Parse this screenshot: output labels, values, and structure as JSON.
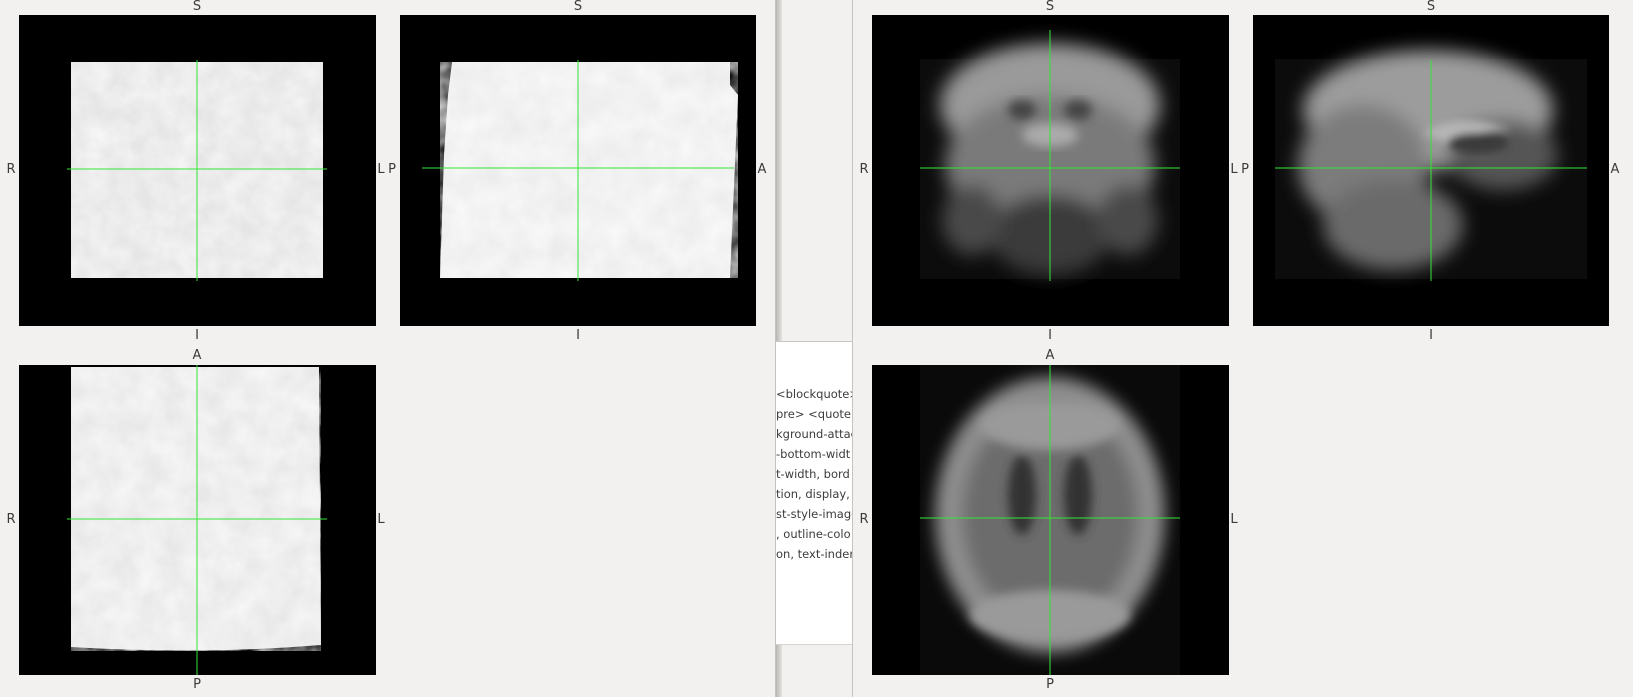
{
  "left_viewer": {
    "views": [
      {
        "id": "coronal",
        "top": "S",
        "bottom": "I",
        "left": "R",
        "right": "L"
      },
      {
        "id": "sagittal",
        "top": "S",
        "bottom": "I",
        "left": "P",
        "right": "A"
      },
      {
        "id": "axial",
        "top": "A",
        "bottom": "P",
        "left": "R",
        "right": "L"
      }
    ]
  },
  "right_viewer": {
    "views": [
      {
        "id": "coronal",
        "top": "S",
        "bottom": "I",
        "left": "R",
        "right": "L"
      },
      {
        "id": "sagittal",
        "top": "S",
        "bottom": "I",
        "left": "P",
        "right": "A"
      },
      {
        "id": "axial",
        "top": "A",
        "bottom": "P",
        "left": "R",
        "right": "L"
      }
    ]
  },
  "background_doc": {
    "lines": [
      "<blockquote>",
      "pre> <quote",
      "kground-attac",
      "-bottom-widt",
      "t-width, bord",
      "tion, display,",
      "st-style-image",
      ", outline-colo",
      "on, text-inden"
    ]
  },
  "colors": {
    "crosshair": "#33e633",
    "panel_bg": "#f2f1f0",
    "view_bg": "#000000"
  }
}
